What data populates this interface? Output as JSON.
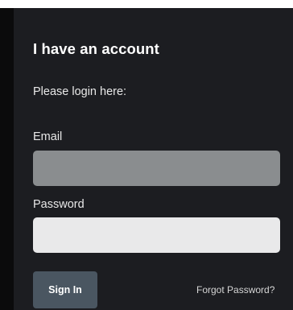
{
  "login": {
    "title": "I have an account",
    "subtitle": "Please login here:",
    "email_label": "Email",
    "email_value": "",
    "password_label": "Password",
    "password_value": "",
    "sign_in_label": "Sign In",
    "forgot_password_label": "Forgot Password?"
  },
  "colors": {
    "panel_background": "#1c1d21",
    "email_field": "#8a8d8f",
    "password_field": "#e9e9ea",
    "sign_in_button": "#4a5661"
  }
}
